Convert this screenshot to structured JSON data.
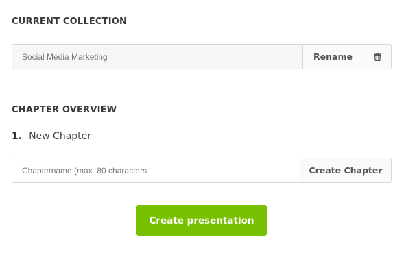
{
  "collection": {
    "section_title": "CURRENT COLLECTION",
    "name_value": "Social Media Marketing",
    "rename_label": "Rename",
    "delete_icon": "trash-icon"
  },
  "chapters": {
    "section_title": "CHAPTER OVERVIEW",
    "items": [
      {
        "number": "1.",
        "title": "New Chapter"
      }
    ],
    "input_placeholder": "Chaptername (max. 80 characters",
    "create_label": "Create Chapter"
  },
  "actions": {
    "create_presentation_label": "Create presentation"
  },
  "colors": {
    "primary_button": "#77c100"
  }
}
